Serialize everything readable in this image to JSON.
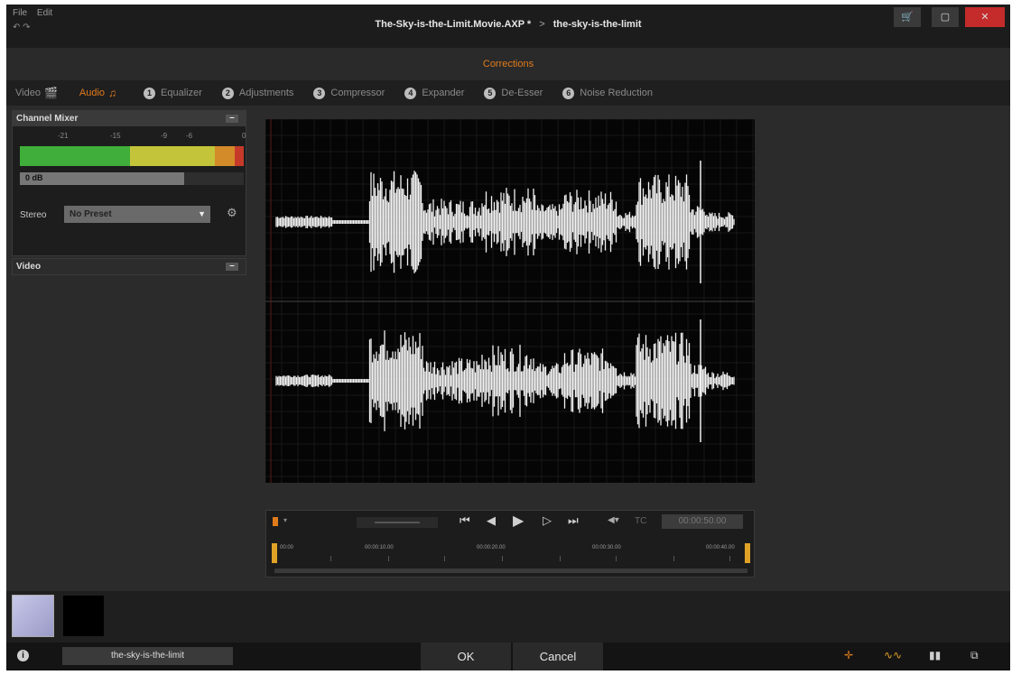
{
  "app": {
    "menu": [
      "File",
      "Edit"
    ],
    "undo_redo": "↶ ↷",
    "title": "The-Sky-is-the-Limit.Movie.AXP *",
    "title_sep": ">",
    "title_item": "the-sky-is-the-limit",
    "window_buttons": {
      "store": "🛒",
      "maximize": "▢",
      "close": "✕"
    }
  },
  "corrections": {
    "label": "Corrections"
  },
  "tabs": [
    {
      "label": "Video",
      "icon": "🎬",
      "active": false
    },
    {
      "label": "Audio",
      "icon": "♫",
      "active": true
    },
    {
      "num": "1",
      "label": "Equalizer"
    },
    {
      "num": "2",
      "label": "Adjustments"
    },
    {
      "num": "3",
      "label": "Compressor"
    },
    {
      "num": "4",
      "label": "Expander"
    },
    {
      "num": "5",
      "label": "De-Esser"
    },
    {
      "num": "6",
      "label": "Noise Reduction"
    }
  ],
  "channel_mixer": {
    "title": "Channel Mixer",
    "collapse": "–",
    "ticks": [
      "-21",
      "-15",
      "-9",
      "-6",
      "0"
    ],
    "level": "0 dB",
    "stereo_label": "Stereo",
    "preset": "No Preset",
    "preset_arrow": "▼",
    "settings_icon": "⚙"
  },
  "video_panel": {
    "title": "Video",
    "collapse": "–"
  },
  "transport": {
    "rec_arrow": "▾",
    "buttons": {
      "to_start": "⏮",
      "step_back": "◀",
      "play": "▶",
      "step_fwd": "▷",
      "to_end": "⏭"
    },
    "volume": "◀▾",
    "tc_label": "TC",
    "timecode": "00:00:50.00",
    "ruler_labels": [
      "00:00",
      "00:00:10.00",
      "00:00:20.00",
      "00:00:30.00",
      "00:00:40.00"
    ]
  },
  "status": {
    "info": "i",
    "project_name": "the-sky-is-the-limit",
    "ok": "OK",
    "cancel": "Cancel"
  }
}
